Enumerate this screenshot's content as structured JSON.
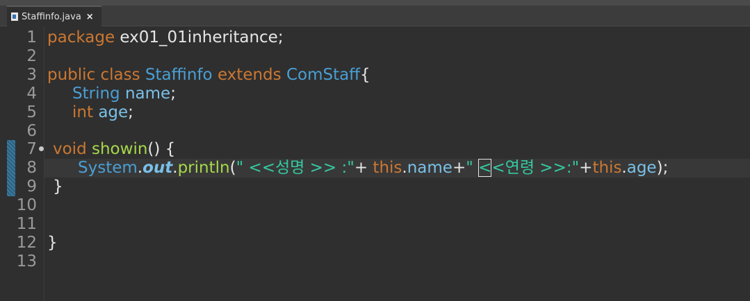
{
  "tab": {
    "filename": "Staffinfo.java",
    "close_glyph": "×"
  },
  "line_numbers": [
    "1",
    "2",
    "3",
    "4",
    "5",
    "6",
    "7",
    "8",
    "9",
    "10",
    "11",
    "12",
    "13"
  ],
  "code": {
    "l1": {
      "kw": "package",
      "rest": " ex01_01inheritance;"
    },
    "l3": {
      "kw1": "public class",
      "cls": "Staffinfo",
      "kw2": "extends",
      "super": "ComStaff",
      "brace": "{"
    },
    "l4": {
      "type": "String",
      "name": "name",
      "semi": ";"
    },
    "l5": {
      "kw": "int",
      "name": "age",
      "semi": ";"
    },
    "l7": {
      "kw": "void",
      "method": "showin",
      "rest": "() {"
    },
    "l8": {
      "sys": "System",
      "dot1": ".",
      "out": "out",
      "dot2": ".",
      "println": "println",
      "open": "(",
      "str1": "\" <<성명 >> :\"",
      "plus1": "+ ",
      "this1": "this",
      "dot3": ".",
      "name": "name",
      "plus2": "+",
      "str2a": "\" ",
      "str2caret": "<",
      "str2b": "<연령 >>:\"",
      "plus3": "+",
      "this2": "this",
      "dot4": ".",
      "age": "age",
      "close": ");"
    },
    "l9": {
      "brace": "}"
    },
    "l12": {
      "brace": "}"
    }
  },
  "colors": {
    "keyword": "#cc7832",
    "type": "#4a9fd4",
    "identifier": "#7ac0e8",
    "method": "#a6d84a",
    "string": "#35c9a0",
    "background": "#2f2f2f"
  }
}
